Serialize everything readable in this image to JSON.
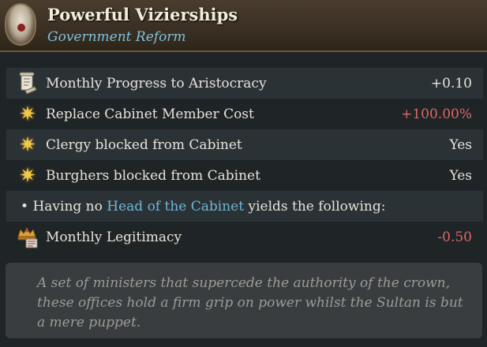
{
  "header": {
    "title": "Powerful Vizierships",
    "subtitle": "Government Reform"
  },
  "rows": [
    {
      "icon": "scroll-icon",
      "label": "Monthly Progress to Aristocracy",
      "value": "+0.10"
    },
    {
      "icon": "star-icon",
      "label": "Replace Cabinet Member Cost",
      "value": "+100.00%"
    },
    {
      "icon": "star-icon",
      "label": "Clergy blocked from Cabinet",
      "value": "Yes"
    },
    {
      "icon": "star-icon",
      "label": "Burghers blocked from Cabinet",
      "value": "Yes"
    }
  ],
  "condition": {
    "bullet": "•",
    "prefix": "Having no ",
    "link": "Head of the Cabinet",
    "suffix": " yields the following:"
  },
  "legitimacy": {
    "icon": "crown-icon",
    "label": "Monthly Legitimacy",
    "value": "-0.50"
  },
  "description": {
    "line1": "A set of ministers that supercede the authority of the crown,",
    "line2": "these offices hold a firm grip on power whilst the Sultan is but",
    "line3": "a mere puppet."
  },
  "colors": {
    "negative": "#e06666",
    "link": "#6fb6d8",
    "subtitle": "#7fc0dc"
  }
}
